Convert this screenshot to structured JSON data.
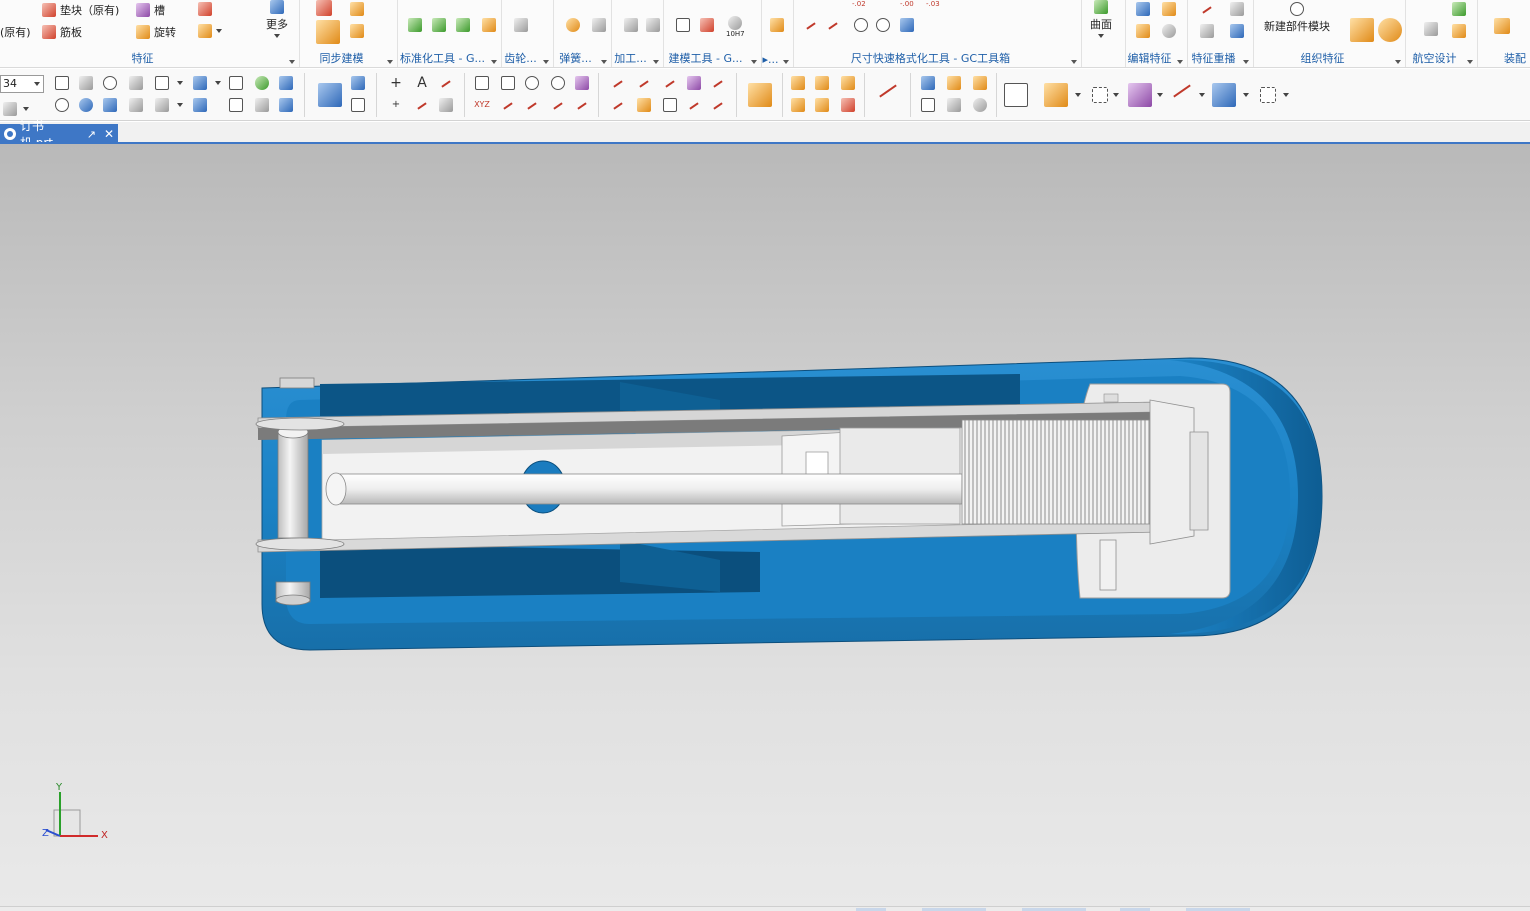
{
  "ribbon": {
    "feature": {
      "label": "特征",
      "items": [
        {
          "label": "(原有)"
        },
        {
          "label": "垫块（原有)"
        },
        {
          "label": "筋板"
        },
        {
          "label": "槽"
        },
        {
          "label": "旋转"
        }
      ]
    },
    "more_label": "更多",
    "sync_label": "同步建模",
    "std_label": "标准化工具 - G...",
    "gear_label": "齿轮...",
    "spring_label": "弹簧...",
    "machining_label": "加工...",
    "modeling_tools_label": "建模工具 - G...",
    "dots_label": "▸...",
    "dim_label": "尺寸快速格式化工具 - GC工具箱",
    "dim_values": [
      "-.02",
      "-.00",
      "-.03"
    ],
    "fit_label": "10H7",
    "surface_label": "曲面",
    "edit_feature_label": "编辑特征",
    "feature_replay_label": "特征重播",
    "new_component_label": "新建部件模块",
    "organize_label": "组织特征",
    "aero_label": "航空设计",
    "assembly_label": "装配"
  },
  "toolbar": {
    "zoom_value": "34",
    "glyphs": {
      "plus": "+",
      "text": "A",
      "xyz": "XYZ"
    }
  },
  "document": {
    "tab_label": "订书机.prt"
  },
  "triad": {
    "x": "X",
    "y": "Y",
    "z": "Z"
  },
  "colors": {
    "accent": "#3e77c6",
    "model_blue": "#1b82c5",
    "model_dark": "#0f5e95",
    "model_light": "#e9e9e9",
    "group_label": "#1f5fa8"
  },
  "icons": [
    "search-icon",
    "rotate-icon",
    "cube-icon",
    "sphere-icon",
    "pan-icon",
    "point-icon",
    "text-icon",
    "arc-icon",
    "rectangle-icon",
    "polygon-icon",
    "circle-icon",
    "measure-icon",
    "layer-icon",
    "grid-icon"
  ]
}
